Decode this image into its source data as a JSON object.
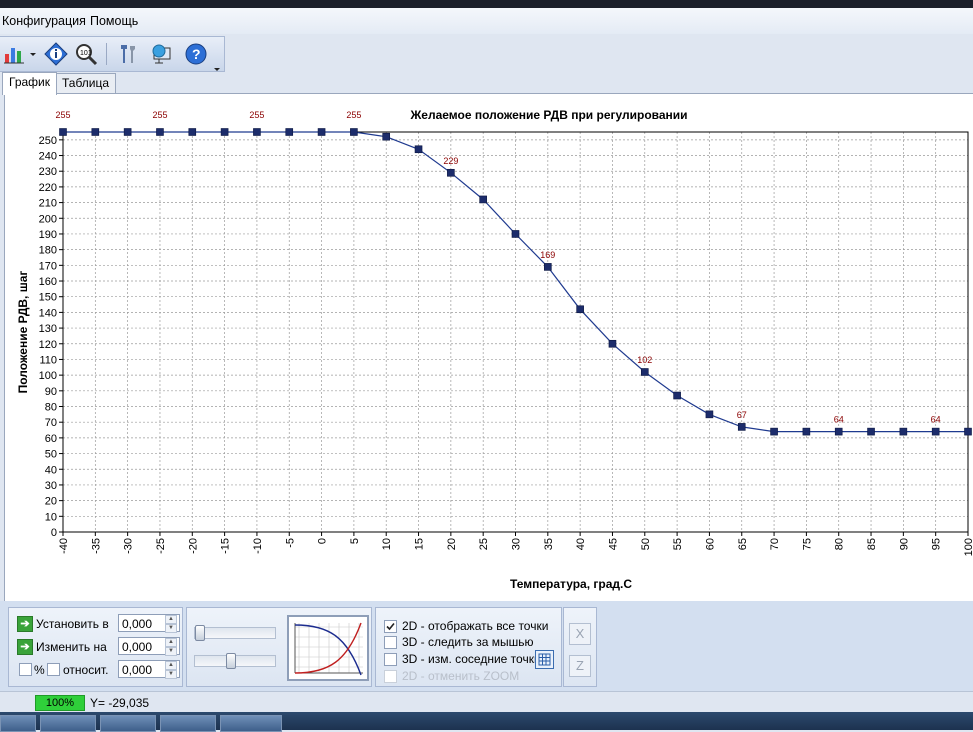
{
  "menu": {
    "items": [
      "Конфигурация",
      "Помощь"
    ]
  },
  "toolbar": {
    "icons": [
      "chart-settings-icon",
      "dropdown-arrow-icon",
      "info-icon",
      "search-zoom-icon",
      "tools-icon",
      "network-icon",
      "help-icon"
    ]
  },
  "tabs": [
    {
      "label": "График",
      "active": true
    },
    {
      "label": "Таблица",
      "active": false
    }
  ],
  "chart_data": {
    "type": "line",
    "title": "Желаемое положение РДВ при регулировании",
    "xlabel": "Температура, град.С",
    "ylabel": "Положение РДВ, шаг",
    "xlim": [
      -40,
      100
    ],
    "ylim": [
      0,
      255
    ],
    "x_ticks": [
      -40,
      -35,
      -30,
      -25,
      -20,
      -15,
      -10,
      -5,
      0,
      5,
      10,
      15,
      20,
      25,
      30,
      35,
      40,
      45,
      50,
      55,
      60,
      65,
      70,
      75,
      80,
      85,
      90,
      95,
      100
    ],
    "y_ticks": [
      0,
      10,
      20,
      30,
      40,
      50,
      60,
      70,
      80,
      90,
      100,
      110,
      120,
      130,
      140,
      150,
      160,
      170,
      180,
      190,
      200,
      210,
      220,
      230,
      240,
      250
    ],
    "grid": true,
    "line_color": "#1f3a8f",
    "marker_color": "#1c2c6b",
    "label_color": "#8b0000",
    "points": [
      {
        "x": -40,
        "y": 255
      },
      {
        "x": -35,
        "y": 255
      },
      {
        "x": -30,
        "y": 255
      },
      {
        "x": -25,
        "y": 255
      },
      {
        "x": -20,
        "y": 255
      },
      {
        "x": -15,
        "y": 255
      },
      {
        "x": -10,
        "y": 255
      },
      {
        "x": -5,
        "y": 255
      },
      {
        "x": 0,
        "y": 255
      },
      {
        "x": 5,
        "y": 255
      },
      {
        "x": 10,
        "y": 252
      },
      {
        "x": 15,
        "y": 244
      },
      {
        "x": 20,
        "y": 229
      },
      {
        "x": 25,
        "y": 212
      },
      {
        "x": 30,
        "y": 190
      },
      {
        "x": 35,
        "y": 169
      },
      {
        "x": 40,
        "y": 142
      },
      {
        "x": 45,
        "y": 120
      },
      {
        "x": 50,
        "y": 102
      },
      {
        "x": 55,
        "y": 87
      },
      {
        "x": 60,
        "y": 75
      },
      {
        "x": 65,
        "y": 67
      },
      {
        "x": 70,
        "y": 64
      },
      {
        "x": 75,
        "y": 64
      },
      {
        "x": 80,
        "y": 64
      },
      {
        "x": 85,
        "y": 64
      },
      {
        "x": 90,
        "y": 64
      },
      {
        "x": 95,
        "y": 64
      },
      {
        "x": 100,
        "y": 64
      }
    ],
    "data_labels": [
      {
        "x": -40,
        "y": 255,
        "text": "255"
      },
      {
        "x": -25,
        "y": 255,
        "text": "255"
      },
      {
        "x": -10,
        "y": 255,
        "text": "255"
      },
      {
        "x": 5,
        "y": 255,
        "text": "255"
      },
      {
        "x": 20,
        "y": 229,
        "text": "229"
      },
      {
        "x": 35,
        "y": 169,
        "text": "169"
      },
      {
        "x": 50,
        "y": 102,
        "text": "102"
      },
      {
        "x": 65,
        "y": 67,
        "text": "67"
      },
      {
        "x": 80,
        "y": 64,
        "text": "64"
      },
      {
        "x": 95,
        "y": 64,
        "text": "64"
      }
    ]
  },
  "controls": {
    "set_label": "Установить в",
    "set_value": "0,000",
    "change_label": "Изменить на",
    "change_value": "0,000",
    "percent_label": "%",
    "relative_label": "относит.",
    "relative_value": "0,000"
  },
  "options": [
    {
      "label": "2D - отображать все точки",
      "checked": true,
      "enabled": true
    },
    {
      "label": "3D - следить за мышью",
      "checked": false,
      "enabled": true
    },
    {
      "label": "3D - изм. соседние точки",
      "checked": false,
      "enabled": true
    },
    {
      "label": "2D - отменить ZOOM",
      "checked": false,
      "enabled": false
    }
  ],
  "side_buttons": {
    "x_label": "X",
    "z_label": "Z"
  },
  "status": {
    "progress_text": "100%",
    "progress_value": 1.0,
    "y_readout": "Y= -29,035"
  }
}
